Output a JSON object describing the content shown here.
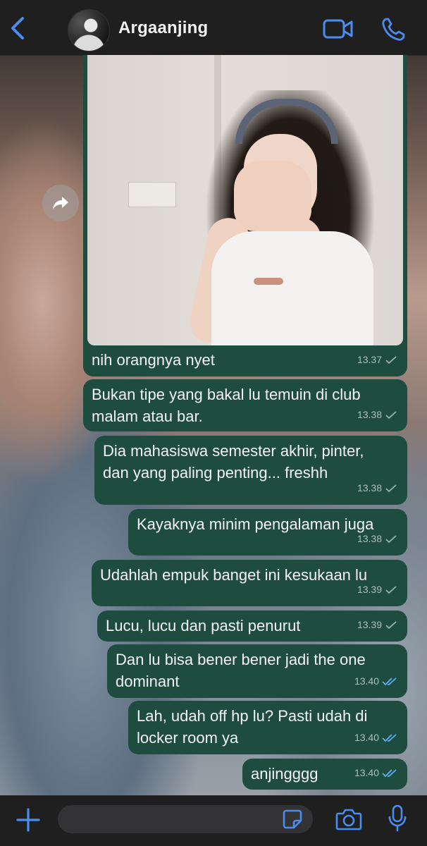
{
  "header": {
    "contact_name": "Argaanjing"
  },
  "chat": {
    "image_message": {
      "caption": "nih orangnya nyet",
      "time": "13.37",
      "status": "sent"
    },
    "messages": [
      {
        "text": "Bukan tipe yang bakal lu temuin di club\nmalam atau bar.",
        "time": "13.38",
        "status": "sent"
      },
      {
        "text": "Dia mahasiswa semester akhir, pinter,\ndan yang paling penting... freshh",
        "time": "13.38",
        "status": "sent"
      },
      {
        "text": "Kayaknya minim pengalaman juga",
        "time": "13.38",
        "status": "sent"
      },
      {
        "text": "Udahlah empuk banget ini kesukaan lu",
        "time": "13.39",
        "status": "sent"
      },
      {
        "text": "Lucu, lucu dan pasti penurut",
        "time": "13.39",
        "status": "sent"
      },
      {
        "text": "Dan lu bisa bener bener jadi the one\ndominant",
        "time": "13.40",
        "status": "read"
      },
      {
        "text": "Lah, udah off hp lu? Pasti udah di\nlocker room ya",
        "time": "13.40",
        "status": "read"
      },
      {
        "text": "anjingggg",
        "time": "13.40",
        "status": "read"
      }
    ]
  },
  "composer": {
    "placeholder": ""
  },
  "colors": {
    "bubble": "#1e4d40",
    "accent_blue": "#4a8cf0",
    "read_tick": "#5fb0f5",
    "sent_tick": "#9bb3ab",
    "bar": "#1f1f1f"
  },
  "icons": {
    "back": "chevron-left-icon",
    "video": "video-camera-icon",
    "call": "phone-icon",
    "forward": "forward-arrow-icon",
    "plus": "plus-icon",
    "sticker": "sticker-icon",
    "camera": "camera-icon",
    "mic": "microphone-icon"
  }
}
